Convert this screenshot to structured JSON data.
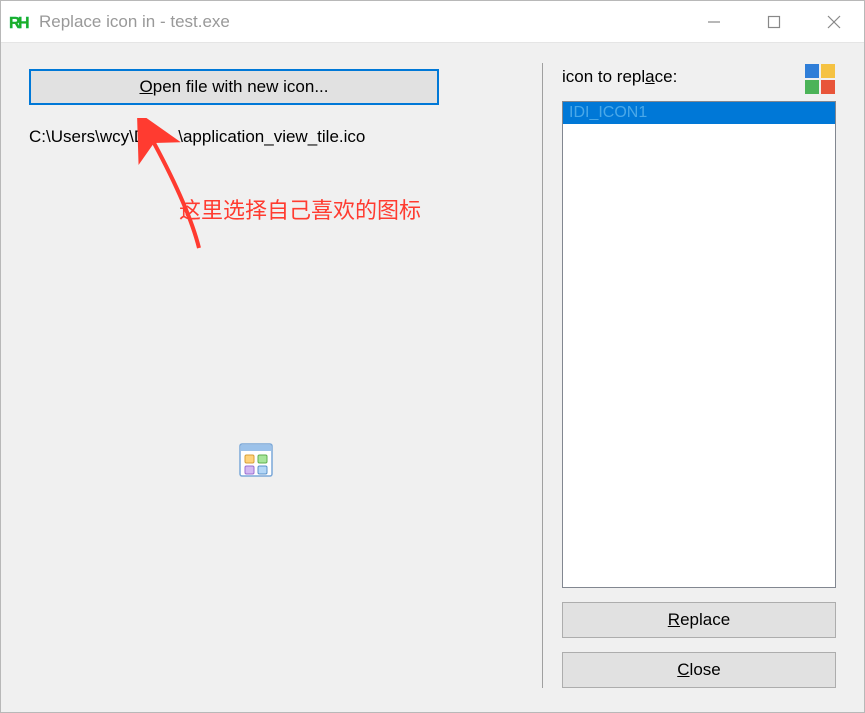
{
  "window": {
    "title": "Replace icon in - test.exe",
    "app_icon_text": "RH"
  },
  "left": {
    "open_button_pre": "",
    "open_button_u": "O",
    "open_button_post": "pen file with new icon...",
    "file_path": "C:\\Users\\wcy\\Des...\\application_view_tile.ico"
  },
  "annotation": {
    "text": "这里选择自己喜欢的图标"
  },
  "right": {
    "label_pre": "icon to repl",
    "label_u": "a",
    "label_post": "ce:",
    "list_items": [
      "IDI_ICON1"
    ],
    "replace_pre": "",
    "replace_u": "R",
    "replace_post": "eplace",
    "close_pre": "",
    "close_u": "C",
    "close_post": "lose"
  }
}
